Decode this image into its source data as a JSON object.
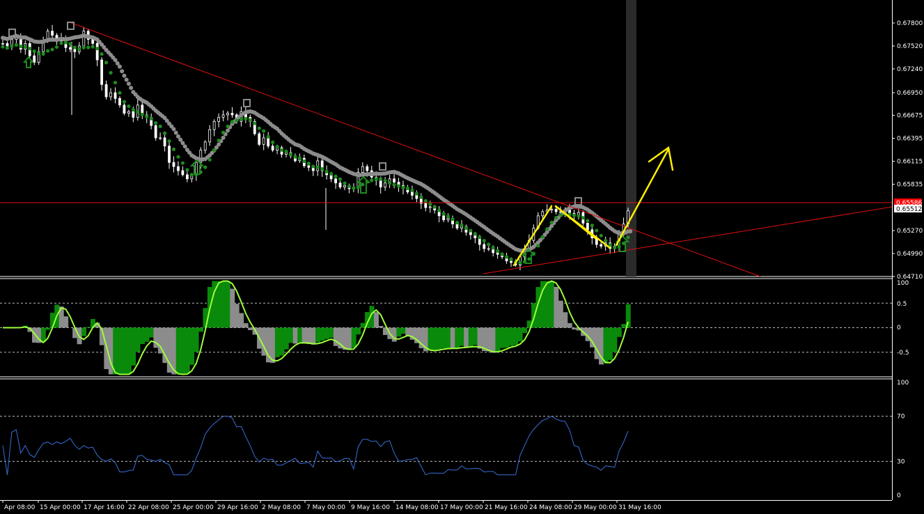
{
  "chart_data": [
    {
      "type": "candlestick",
      "panel": "price",
      "y_ticks": [
        "0.67800",
        "0.67520",
        "0.67240",
        "0.66950",
        "0.66675",
        "0.66395",
        "0.66115",
        "0.65835",
        "0.65270",
        "0.64990",
        "0.64710"
      ],
      "ylim": [
        0.6471,
        0.6808
      ],
      "current_price_label": "0.65512",
      "level_price_label": "0.65586",
      "level_price": 0.65586,
      "current_price": 0.65512,
      "close_series": [
        0.6755,
        0.6752,
        0.676,
        0.6762,
        0.6748,
        0.6755,
        0.674,
        0.6732,
        0.6745,
        0.6758,
        0.677,
        0.6765,
        0.6758,
        0.676,
        0.675,
        0.6748,
        0.6745,
        0.6752,
        0.677,
        0.676,
        0.6755,
        0.6735,
        0.6705,
        0.669,
        0.6695,
        0.6688,
        0.668,
        0.667,
        0.6672,
        0.6665,
        0.668,
        0.6668,
        0.6665,
        0.6655,
        0.664,
        0.664,
        0.663,
        0.661,
        0.6605,
        0.66,
        0.6595,
        0.659,
        0.6594,
        0.661,
        0.6625,
        0.6635,
        0.665,
        0.666,
        0.6665,
        0.6668,
        0.667,
        0.6668,
        0.666,
        0.6672,
        0.6665,
        0.666,
        0.6645,
        0.6632,
        0.664,
        0.663,
        0.6625,
        0.6628,
        0.662,
        0.6622,
        0.6618,
        0.6612,
        0.6615,
        0.6606,
        0.6604,
        0.66,
        0.6612,
        0.66,
        0.6595,
        0.659,
        0.6585,
        0.658,
        0.6582,
        0.6578,
        0.658,
        0.6598,
        0.6605,
        0.66,
        0.6592,
        0.6588,
        0.658,
        0.6585,
        0.659,
        0.6586,
        0.6582,
        0.6578,
        0.6574,
        0.657,
        0.6566,
        0.656,
        0.6555,
        0.6556,
        0.6552,
        0.6545,
        0.654,
        0.6542,
        0.6535,
        0.653,
        0.6532,
        0.6525,
        0.6522,
        0.6518,
        0.651,
        0.6505,
        0.6505,
        0.65,
        0.6498,
        0.6495,
        0.649,
        0.6488,
        0.6485,
        0.6495,
        0.6505,
        0.6515,
        0.653,
        0.6545,
        0.655,
        0.6552,
        0.6553,
        0.655,
        0.6549,
        0.6552,
        0.6548,
        0.6545,
        0.6549,
        0.6536,
        0.6528,
        0.6518,
        0.651,
        0.6508,
        0.6512,
        0.6505,
        0.6508,
        0.6525,
        0.6535,
        0.6551
      ]
    },
    {
      "type": "histogram",
      "panel": "oscillator",
      "y_ticks": [
        "100",
        "0.5",
        "0",
        "-0.5"
      ],
      "ylim": [
        -1.0,
        1.0
      ]
    },
    {
      "type": "line",
      "panel": "rsi",
      "y_ticks": [
        "100",
        "70",
        "30",
        "0"
      ],
      "ylim": [
        0,
        100
      ],
      "color": "#3a6fd8"
    }
  ],
  "x_axis_labels": [
    "Apr 08:00",
    "15 Apr 00:00",
    "17 Apr 16:00",
    "22 Apr 08:00",
    "25 Apr 00:00",
    "29 Apr 16:00",
    "2 May 08:00",
    "7 May 00:00",
    "9 May 16:00",
    "14 May 08:00",
    "17 May 00:00",
    "21 May 16:00",
    "24 May 08:00",
    "29 May 00:00",
    "31 May 16:00"
  ],
  "colors": {
    "background": "#000000",
    "candle": "#ffffff",
    "fast_ma": "#1e8c1e",
    "slow_ma": "#8c8c8c",
    "trendline": "#ff2020",
    "arrows": "#ffee00",
    "osc_up": "#0a8a0a",
    "osc_down": "#8c8c8c",
    "osc_signal": "#9cff3a",
    "price_tag_bg": "#ff0000"
  }
}
